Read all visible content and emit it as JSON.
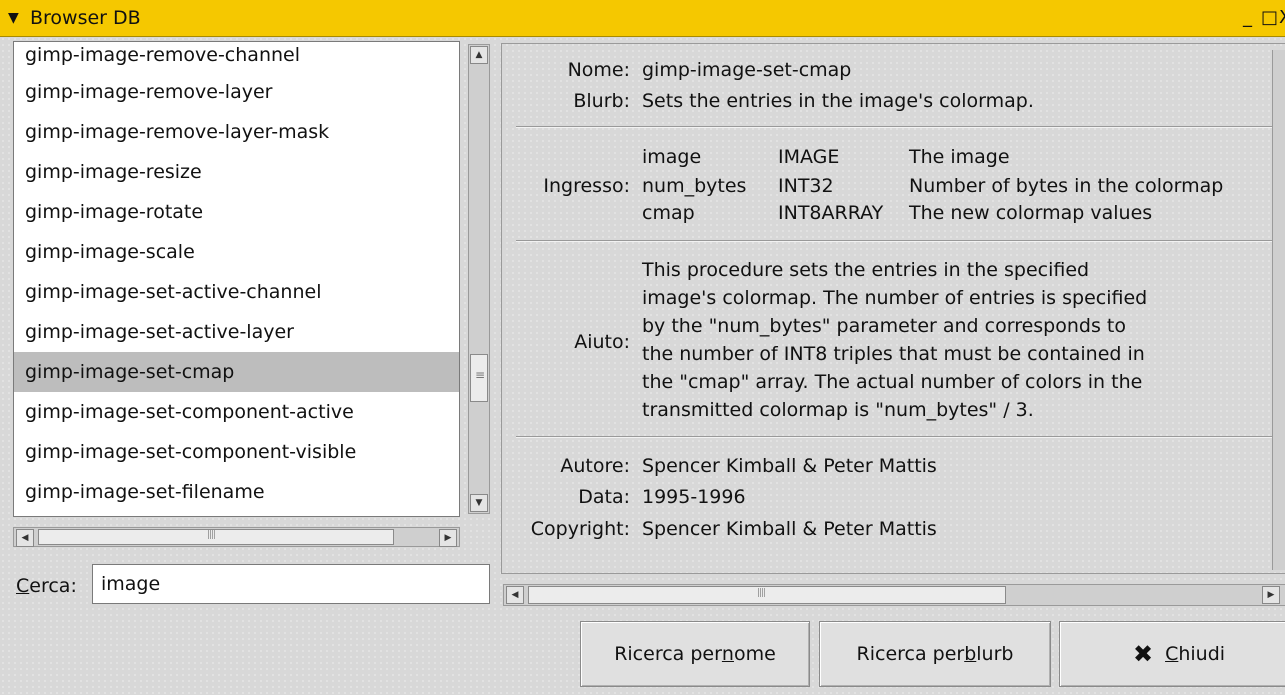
{
  "window": {
    "title": "Browser DB",
    "menu_arrow": "▼",
    "controls": {
      "minimize": "_",
      "maximize": "□",
      "close": "X"
    }
  },
  "procedure_list": {
    "items": [
      "gimp-image-remove-channel",
      "gimp-image-remove-layer",
      "gimp-image-remove-layer-mask",
      "gimp-image-resize",
      "gimp-image-rotate",
      "gimp-image-scale",
      "gimp-image-set-active-channel",
      "gimp-image-set-active-layer",
      "gimp-image-set-cmap",
      "gimp-image-set-component-active",
      "gimp-image-set-component-visible",
      "gimp-image-set-filename"
    ],
    "selected_index": 8
  },
  "search": {
    "label_first": "C",
    "label_rest": "erca:",
    "value": "image"
  },
  "details": {
    "name_label": "Nome:",
    "name_value": "gimp-image-set-cmap",
    "blurb_label": "Blurb:",
    "blurb_value": "Sets the entries in the image's colormap.",
    "input_label": "Ingresso:",
    "params": [
      {
        "name": "image",
        "type": "IMAGE",
        "desc": "The image"
      },
      {
        "name": "num_bytes",
        "type": "INT32",
        "desc": "Number of bytes in the colormap"
      },
      {
        "name": "cmap",
        "type": "INT8ARRAY",
        "desc": "The new colormap values"
      }
    ],
    "help_label": "Aiuto:",
    "help_lines": [
      "This procedure sets the entries in the specified",
      "image's colormap. The number of entries is specified",
      "by the \"num_bytes\" parameter and corresponds to",
      "the number of INT8 triples that must be contained in",
      "the \"cmap\" array. The actual number of colors in the",
      "transmitted colormap is \"num_bytes\" / 3."
    ],
    "author_label": "Autore:",
    "author_value": "Spencer Kimball & Peter Mattis",
    "date_label": "Data:",
    "date_value": "1995-1996",
    "copyright_label": "Copyright:",
    "copyright_value": "Spencer Kimball & Peter Mattis"
  },
  "buttons": {
    "search_name_pre": "Ricerca per ",
    "search_name_u": "n",
    "search_name_post": "ome",
    "search_blurb_pre": "Ricerca per ",
    "search_blurb_u": "b",
    "search_blurb_post": "lurb",
    "close_icon": "✖",
    "close_u": "C",
    "close_post": "hiudi"
  }
}
